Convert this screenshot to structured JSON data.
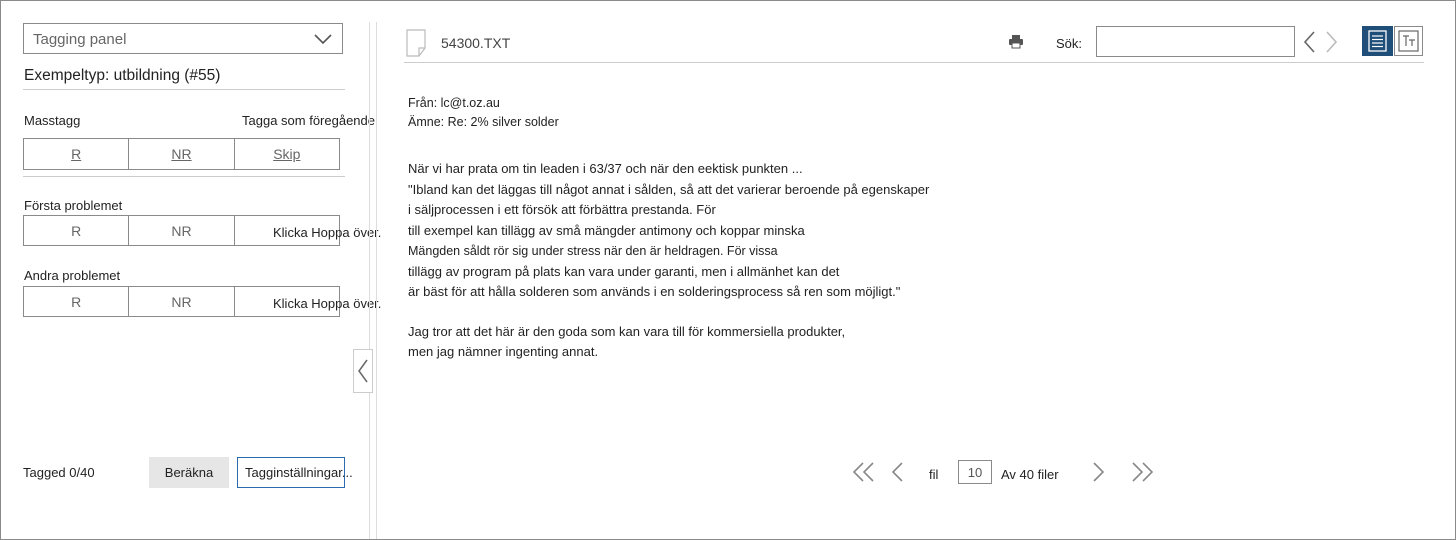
{
  "left_panel": {
    "dropdown_label": "Tagging panel",
    "example_type": "Exempeltyp: utbildning (#55)",
    "mass_tag_label": "Masstagg",
    "tag_previous_label": "Tagga som föregående",
    "mass_buttons": [
      "R",
      "NR",
      "Skip"
    ],
    "problems": [
      {
        "label": "Första problemet",
        "buttons": [
          "R",
          "NR"
        ],
        "skip_hint": "Klicka Hoppa över."
      },
      {
        "label": "Andra problemet",
        "buttons": [
          "R",
          "NR"
        ],
        "skip_hint": "Klicka Hoppa över."
      }
    ],
    "tagged_count": "Tagged 0/40",
    "calculate_label": "Beräkna",
    "settings_label": "Tagginställningar..."
  },
  "document": {
    "file_name": "54300.TXT",
    "search_label": "Sök:",
    "search_value": "",
    "from_line": "Från: lc@t.oz.au",
    "subject_line": "Ämne: Re: 2% silver solder",
    "body_lines": [
      "När vi har prata om tin leaden i 63/37 och när den eektisk punkten ...",
      "\"Ibland kan det läggas till något annat i sålden, så att det varierar beroende på egenskaper",
      "i säljprocessen i ett försök att förbättra prestanda. För",
      "till exempel kan tillägg av små mängder antimony och koppar minska",
      "Mängden såldt rör sig under stress när den är heldragen. För vissa",
      "tillägg av program på plats kan vara under garanti, men i allmänhet kan det",
      "är bäst för att hålla solderen som används i en solderingsprocess så ren som möjligt.\""
    ],
    "closing_lines": [
      "Jag tror att det här är den goda som kan vara till för kommersiella produkter,",
      "men jag nämner ingenting annat."
    ]
  },
  "pager": {
    "file_label": "fil",
    "current_page": "10",
    "total_label": "Av 40 filer"
  },
  "colors": {
    "accent": "#1f4e79",
    "focus_border": "#2b6cb0",
    "border": "#8a8a8a"
  }
}
